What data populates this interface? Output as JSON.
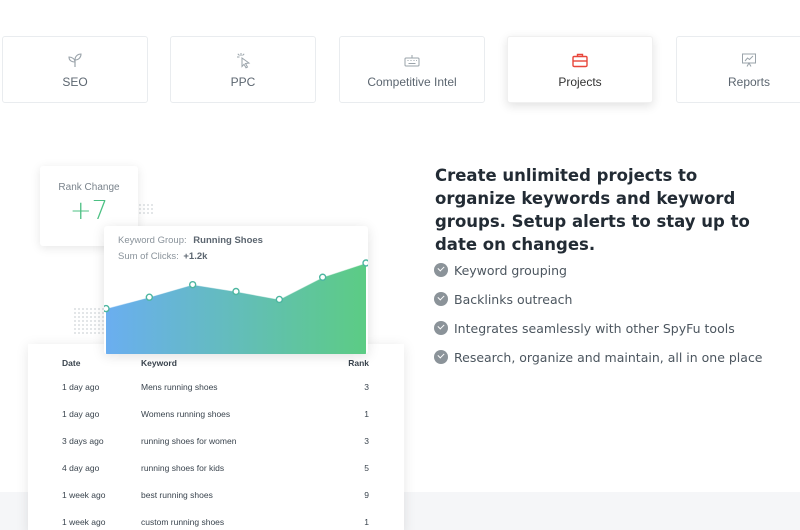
{
  "tabs": [
    {
      "label": "SEO",
      "icon": "seedling-icon",
      "active": false
    },
    {
      "label": "PPC",
      "icon": "cursor-click-icon",
      "active": false
    },
    {
      "label": "Competitive Intel",
      "icon": "keyboard-icon",
      "active": false
    },
    {
      "label": "Projects",
      "icon": "briefcase-icon",
      "active": true
    },
    {
      "label": "Reports",
      "icon": "chart-presentation-icon",
      "active": false
    }
  ],
  "colors": {
    "accent_red": "#e8463b",
    "green": "#4cc083",
    "chart_start": "#6aaef0",
    "chart_end": "#5ccc84"
  },
  "rank_change": {
    "title": "Rank Change",
    "value": "+7"
  },
  "chart": {
    "keyword_group_label": "Keyword Group:",
    "keyword_group_value": "Running Shoes",
    "sum_clicks_label": "Sum of Clicks:",
    "sum_clicks_value": "+1.2k"
  },
  "chart_data": {
    "type": "area",
    "x": [
      1,
      2,
      3,
      4,
      5,
      6,
      7
    ],
    "values": [
      0.2,
      0.4,
      0.62,
      0.5,
      0.36,
      0.75,
      1.0
    ],
    "title": "",
    "xlabel": "",
    "ylabel": ""
  },
  "table": {
    "headers": {
      "date": "Date",
      "keyword": "Keyword",
      "rank": "Rank"
    },
    "rows": [
      {
        "date": "1 day ago",
        "keyword": "Mens running shoes",
        "rank": "3"
      },
      {
        "date": "1 day ago",
        "keyword": "Womens running shoes",
        "rank": "1"
      },
      {
        "date": "3 days ago",
        "keyword": "running shoes for women",
        "rank": "3"
      },
      {
        "date": "4 day ago",
        "keyword": "running shoes for kids",
        "rank": "5"
      },
      {
        "date": "1 week ago",
        "keyword": "best running shoes",
        "rank": "9"
      },
      {
        "date": "1 week ago",
        "keyword": "custom running shoes",
        "rank": "1"
      }
    ]
  },
  "copy": {
    "heading": "Create unlimited projects to organize keywords and keyword groups. Setup alerts to stay up to date on changes.",
    "features": [
      "Keyword grouping",
      "Backlinks outreach",
      "Integrates seamlessly with other SpyFu tools",
      "Research, organize and maintain, all in one place"
    ]
  }
}
